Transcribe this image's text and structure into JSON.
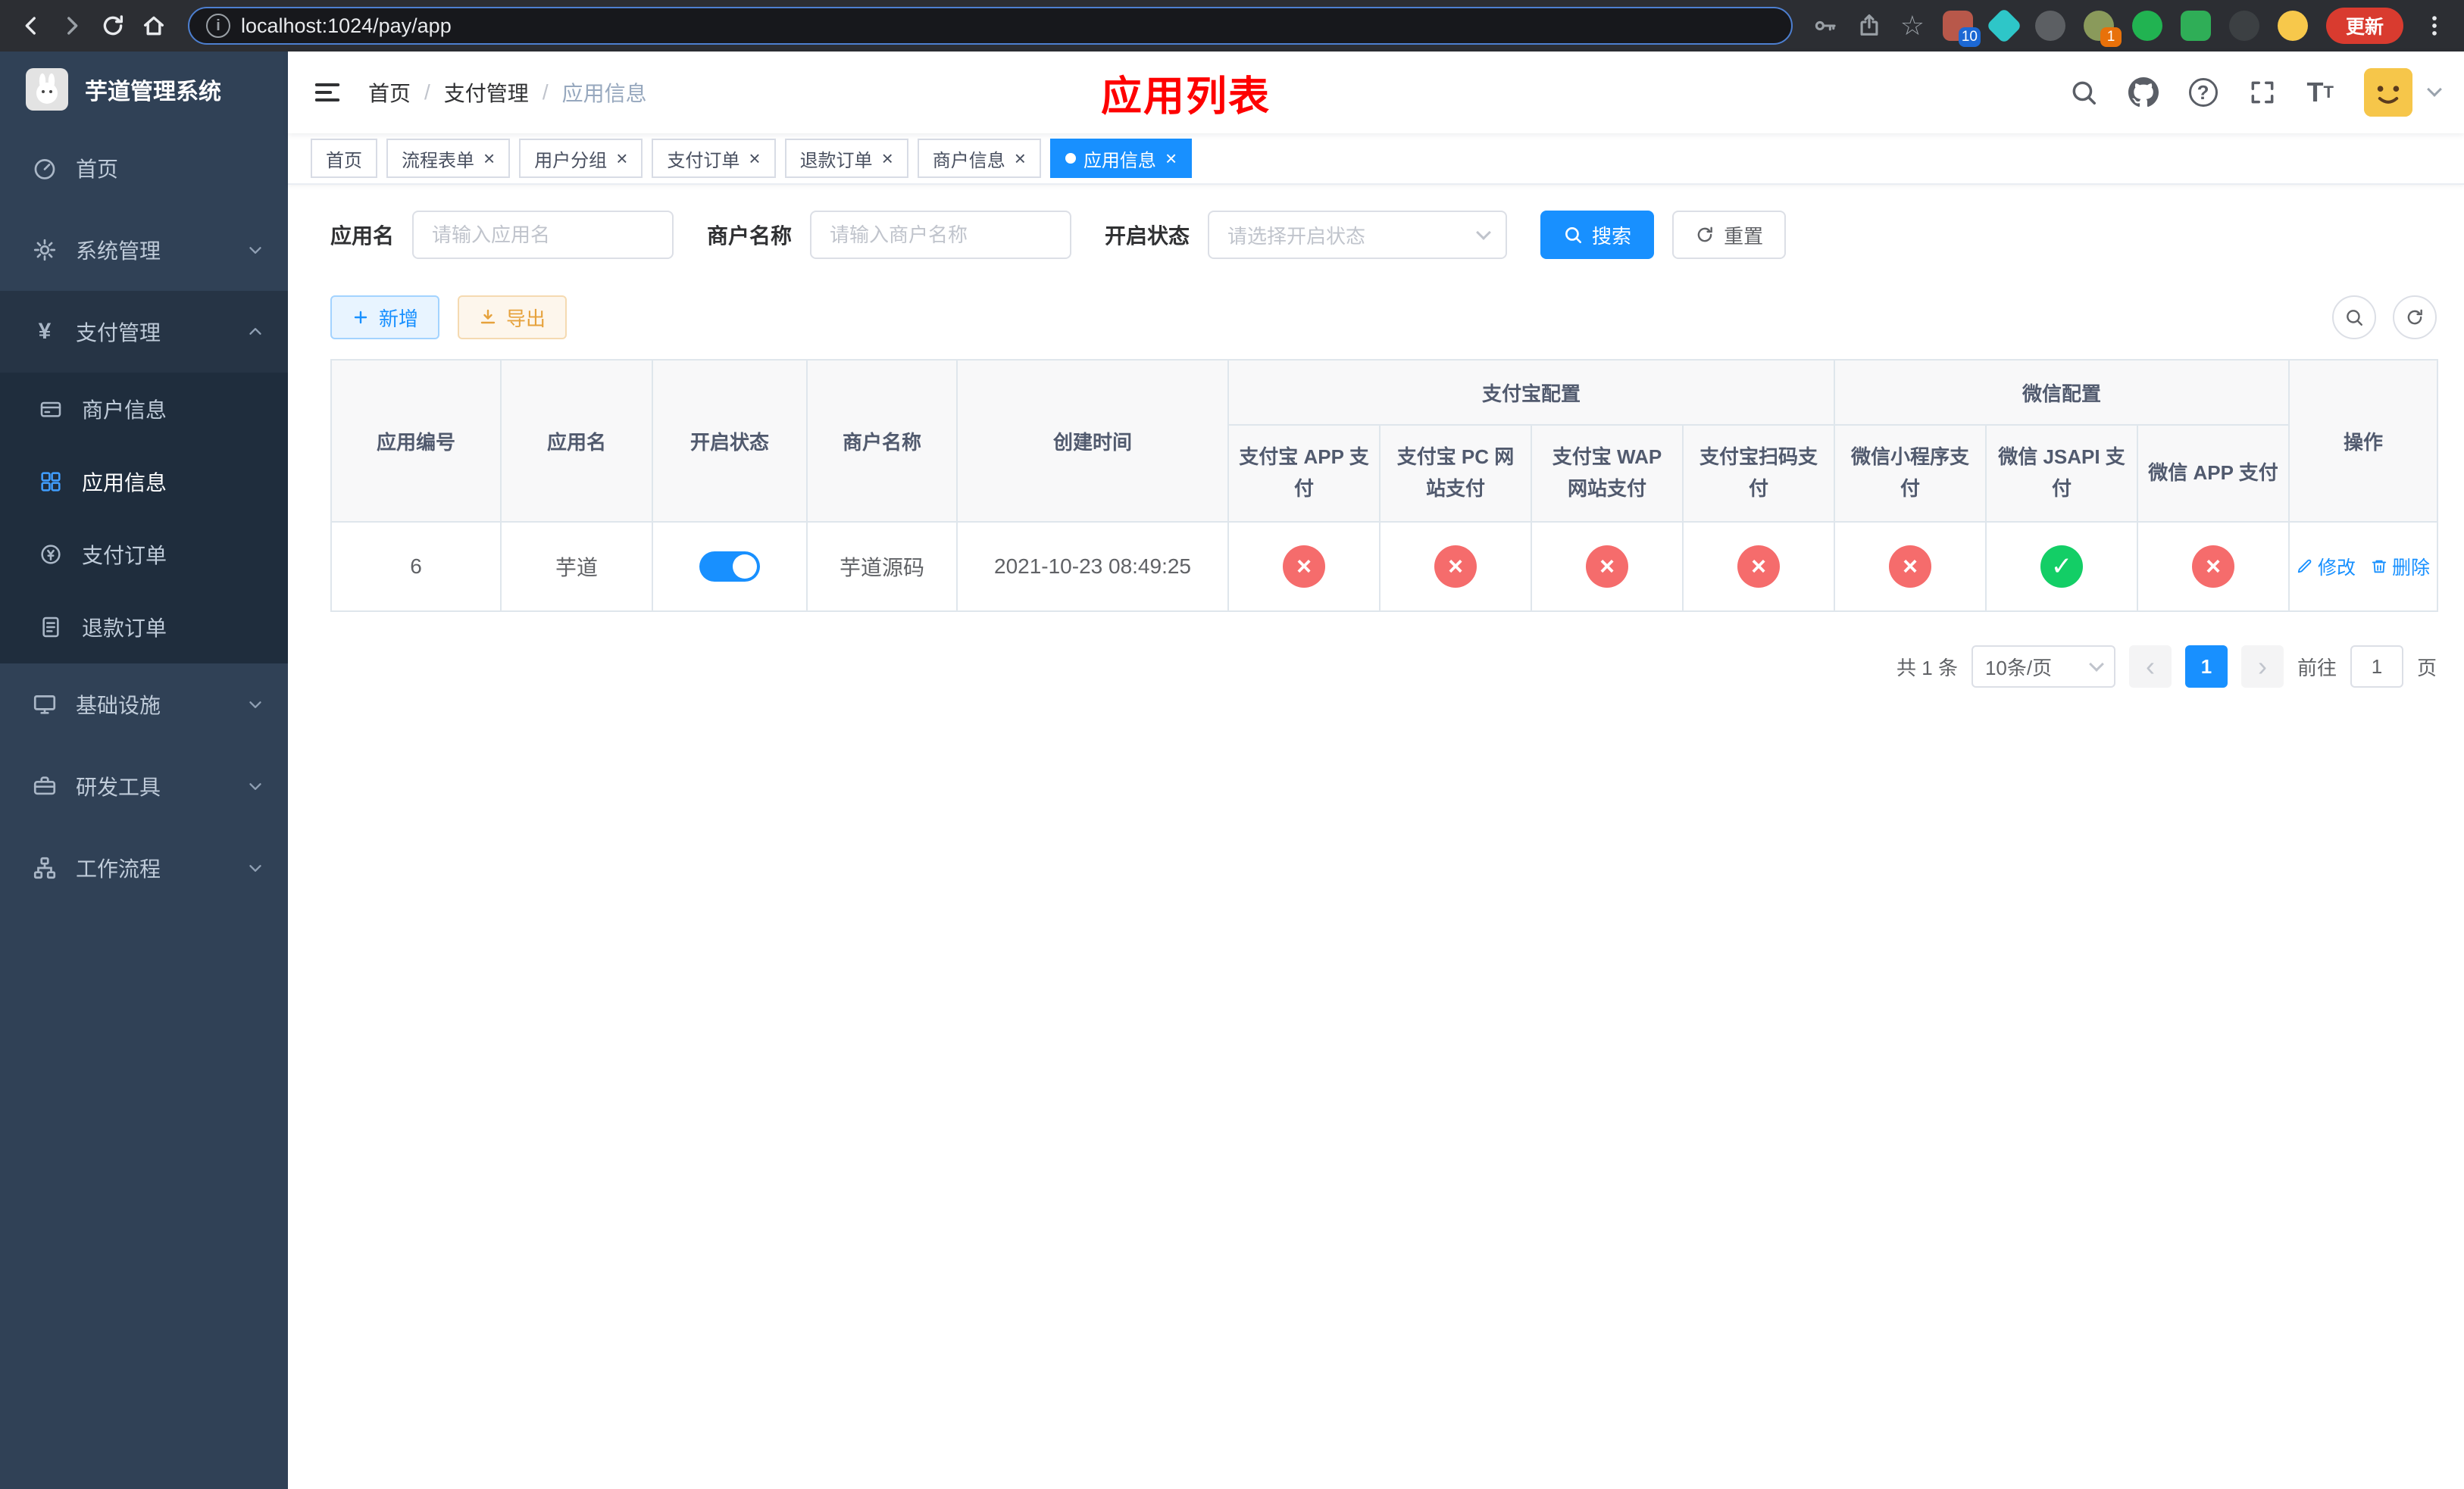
{
  "browser": {
    "url": "localhost:1024/pay/app",
    "update_button": "更新",
    "extensions": [
      {
        "name": "extension-colorful",
        "shape": "square",
        "color": "#b8584a",
        "badge": "10",
        "badge_color": "#1c68d4"
      },
      {
        "name": "extension-teal-diamond",
        "shape": "diamond",
        "color": "#2ec6c8",
        "badge": "",
        "badge_color": ""
      },
      {
        "name": "extension-dark-circle",
        "shape": "circle",
        "color": "#5c5f63",
        "badge": "",
        "badge_color": ""
      },
      {
        "name": "extension-avatar",
        "shape": "circle",
        "color": "#8a9a5b",
        "badge": "1",
        "badge_color": "#e8710a"
      },
      {
        "name": "extension-green-circle",
        "shape": "circle",
        "color": "#21b351",
        "badge": "",
        "badge_color": ""
      },
      {
        "name": "extension-green-square",
        "shape": "square",
        "color": "#2fae57",
        "badge": "",
        "badge_color": ""
      },
      {
        "name": "extension-pinwheel",
        "shape": "circle",
        "color": "#3c4043",
        "badge": "",
        "badge_color": ""
      },
      {
        "name": "extension-emoji-face",
        "shape": "circle",
        "color": "#f7c84b",
        "badge": "",
        "badge_color": ""
      }
    ]
  },
  "sidebar": {
    "logo_text": "芋道管理系统",
    "menu": [
      {
        "label": "首页",
        "icon": "dashboard-icon"
      },
      {
        "label": "系统管理",
        "icon": "gear-icon"
      },
      {
        "label": "支付管理",
        "icon": "yen-icon",
        "children": [
          {
            "label": "商户信息",
            "icon": "merchant-card-icon"
          },
          {
            "label": "应用信息",
            "icon": "app-grid-icon",
            "active": true
          },
          {
            "label": "支付订单",
            "icon": "pay-order-icon"
          },
          {
            "label": "退款订单",
            "icon": "refund-order-icon"
          }
        ]
      },
      {
        "label": "基础设施",
        "icon": "infrastructure-icon"
      },
      {
        "label": "研发工具",
        "icon": "devtools-icon"
      },
      {
        "label": "工作流程",
        "icon": "workflow-icon"
      }
    ]
  },
  "header": {
    "breadcrumb": [
      "首页",
      "支付管理",
      "应用信息"
    ],
    "page_title": "应用列表"
  },
  "tabs": [
    {
      "label": "首页",
      "closable": false,
      "active": false
    },
    {
      "label": "流程表单",
      "closable": true,
      "active": false
    },
    {
      "label": "用户分组",
      "closable": true,
      "active": false
    },
    {
      "label": "支付订单",
      "closable": true,
      "active": false
    },
    {
      "label": "退款订单",
      "closable": true,
      "active": false
    },
    {
      "label": "商户信息",
      "closable": true,
      "active": false
    },
    {
      "label": "应用信息",
      "closable": true,
      "active": true
    }
  ],
  "filters": {
    "app_name_label": "应用名",
    "app_name_placeholder": "请输入应用名",
    "merchant_label": "商户名称",
    "merchant_placeholder": "请输入商户名称",
    "status_label": "开启状态",
    "status_placeholder": "请选择开启状态",
    "search_button": "搜索",
    "reset_button": "重置"
  },
  "toolbar": {
    "add_button": "新增",
    "export_button": "导出"
  },
  "table": {
    "simple_headers": [
      "应用编号",
      "应用名",
      "开启状态",
      "商户名称",
      "创建时间"
    ],
    "group_headers": [
      {
        "label": "支付宝配置",
        "span": 4
      },
      {
        "label": "微信配置",
        "span": 3
      }
    ],
    "sub_headers": [
      "支付宝 APP 支付",
      "支付宝 PC 网站支付",
      "支付宝 WAP 网站支付",
      "支付宝扫码支付",
      "微信小程序支付",
      "微信 JSAPI 支付",
      "微信 APP 支付"
    ],
    "action_header": "操作",
    "rows": [
      {
        "app_id": "6",
        "app_name": "芋道",
        "status_on": true,
        "merchant_name": "芋道源码",
        "created_at": "2021-10-23 08:49:25",
        "pay_configs": [
          "no",
          "no",
          "no",
          "no",
          "no",
          "yes",
          "no"
        ],
        "edit_label": "修改",
        "delete_label": "删除"
      }
    ]
  },
  "pagination": {
    "total_text": "共 1 条",
    "page_size": "10条/页",
    "current_page": "1",
    "goto_prefix": "前往",
    "goto_value": "1",
    "goto_suffix": "页"
  },
  "colors": {
    "primary": "#1890ff",
    "title_red": "#fe0000",
    "status_no": "#f56c6c",
    "status_yes": "#13ce66",
    "sidebar_bg": "#304156",
    "submenu_bg": "#1f2d3d"
  },
  "icons": {
    "close-icon": "×",
    "check-icon": "✓",
    "cross-icon": "×",
    "star-icon": "☆",
    "prev-icon": "‹",
    "next-icon": "›"
  }
}
